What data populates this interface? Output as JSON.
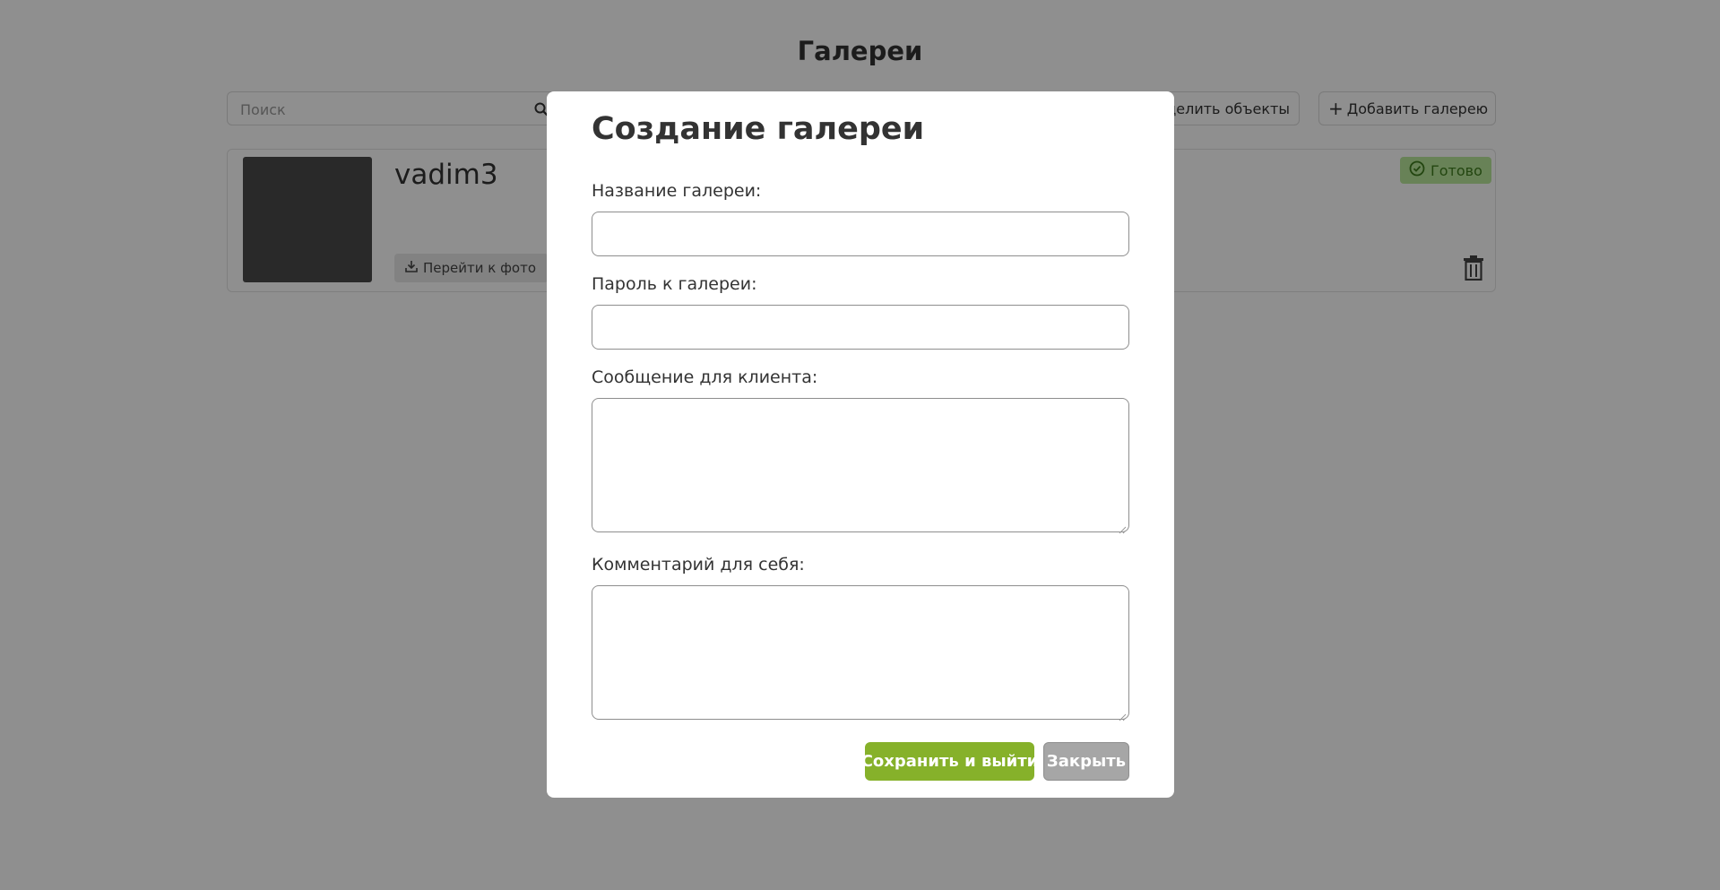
{
  "page": {
    "title": "Галереи"
  },
  "toolbar": {
    "search_placeholder": "Поиск",
    "search_icon": "search-icon",
    "select_objects_label": "делить объекты",
    "add_gallery_label": "Добавить галерею"
  },
  "galleries": [
    {
      "name": "vadim3",
      "goto_label": "Перейти к фото",
      "status": "Готово",
      "status_color": "#b9e89c"
    }
  ],
  "modal": {
    "title": "Создание галереи",
    "fields": [
      {
        "label": "Название галереи:",
        "value": ""
      },
      {
        "label": "Пароль к галереи:",
        "value": ""
      },
      {
        "label": "Сообщение для клиента:",
        "value": ""
      },
      {
        "label": "Комментарий для себя:",
        "value": ""
      }
    ],
    "save_label": "Сохранить и выйти",
    "close_label": "Закрыть"
  },
  "colors": {
    "accent": "#86b12a",
    "overlay": "rgba(0,0,0,0.44)",
    "secondary_button": "#a6a6a6"
  }
}
